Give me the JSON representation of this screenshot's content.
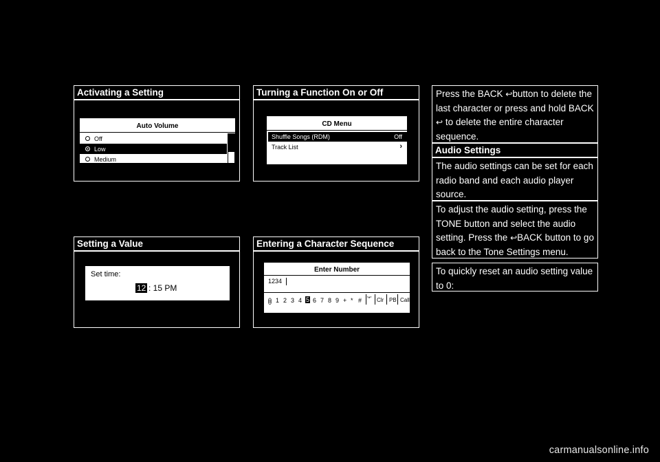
{
  "sections": {
    "activating": {
      "heading": "Activating a Setting",
      "screen": {
        "title": "Auto Volume",
        "options": [
          {
            "label": "Off",
            "selected": false
          },
          {
            "label": "Low",
            "selected": true
          },
          {
            "label": "Medium",
            "selected": false
          }
        ]
      }
    },
    "turning": {
      "heading": "Turning a Function On or Off",
      "screen": {
        "title": "CD Menu",
        "rows": [
          {
            "label": "Shuffle Songs (RDM)",
            "value": "Off",
            "selected": true
          },
          {
            "label": "Track List",
            "value": "›",
            "selected": false
          }
        ]
      }
    },
    "setting_value": {
      "heading": "Setting a Value",
      "screen": {
        "label": "Set time:",
        "hour": "12",
        "rest": ": 15 PM"
      }
    },
    "entering_sequence": {
      "heading": "Entering a Character Sequence",
      "screen": {
        "title": "Enter Number",
        "entry": "1234",
        "keys": [
          "0",
          "1",
          "2",
          "3",
          "4",
          "5",
          "6",
          "7",
          "8",
          "9",
          "+",
          "*",
          "#"
        ],
        "highlighted_key": "5",
        "extra_keys": [
          "Clr",
          "PB",
          "Call"
        ]
      }
    },
    "audio": {
      "heading": "Audio Settings",
      "paragraphs": [
        {
          "id": "backspace",
          "parts": [
            {
              "type": "text",
              "text": "Press the BACK "
            },
            {
              "type": "icon",
              "text": "↶"
            },
            {
              "type": "text",
              "text": "button to delete the last character or press and hold BACK "
            },
            {
              "type": "icon",
              "text": "↶"
            },
            {
              "type": "text",
              "text": " to delete the entire character sequence."
            }
          ]
        },
        {
          "id": "audio-intro",
          "parts": [
            {
              "type": "text",
              "text": "The audio settings can be set for each radio band and each audio player source."
            }
          ]
        },
        {
          "id": "audio-adjust",
          "parts": [
            {
              "type": "text",
              "text": "To adjust the audio setting, press the TONE button and select the audio setting. Press the "
            },
            {
              "type": "icon",
              "text": "↶"
            },
            {
              "type": "text",
              "text": "BACK button to go back to the Tone Settings menu."
            }
          ]
        },
        {
          "id": "audio-reset",
          "parts": [
            {
              "type": "text",
              "text": "To quickly reset an audio setting value to 0:"
            }
          ]
        }
      ]
    }
  },
  "footer": {
    "text": "carmanualsonline.info"
  }
}
